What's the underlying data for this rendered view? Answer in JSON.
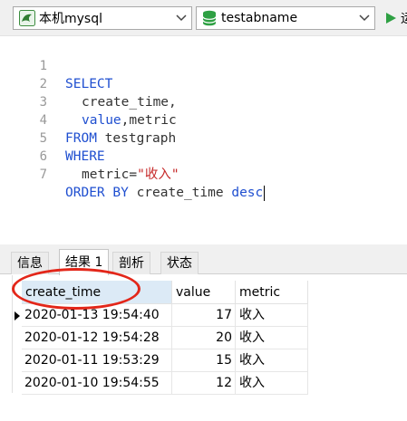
{
  "toolbar": {
    "connection": "本机mysql",
    "database": "testabname",
    "run_label": "运"
  },
  "editor": {
    "lines": [
      {
        "n": "1"
      },
      {
        "n": "2"
      },
      {
        "n": "3"
      },
      {
        "n": "4"
      },
      {
        "n": "5"
      },
      {
        "n": "6"
      },
      {
        "n": "7"
      }
    ],
    "tokens": {
      "select": "SELECT",
      "create_time": "create_time,",
      "value": "value",
      "metric_col": ",metric",
      "from": "FROM",
      "table": " testgraph",
      "where": "WHERE",
      "metric_eq": "metric=",
      "metric_val": "\"收入\"",
      "order_by": "ORDER BY",
      "order_col": " create_time ",
      "desc": "desc"
    }
  },
  "tabs": [
    {
      "label": "信息"
    },
    {
      "label": "结果 1"
    },
    {
      "label": "剖析"
    },
    {
      "label": "状态"
    }
  ],
  "grid": {
    "columns": [
      "create_time",
      "value",
      "metric"
    ],
    "rows": [
      {
        "create_time": "2020-01-13 19:54:40",
        "value": "17",
        "metric": "收入"
      },
      {
        "create_time": "2020-01-12 19:54:28",
        "value": "20",
        "metric": "收入"
      },
      {
        "create_time": "2020-01-11 19:53:29",
        "value": "15",
        "metric": "收入"
      },
      {
        "create_time": "2020-01-10 19:54:55",
        "value": "12",
        "metric": "收入"
      }
    ]
  },
  "colors": {
    "keyword": "#1f4fd0",
    "string": "#c62828",
    "annotation": "#e32619",
    "header_selected": "#dceaf6",
    "db_icon": "#2ea043"
  }
}
